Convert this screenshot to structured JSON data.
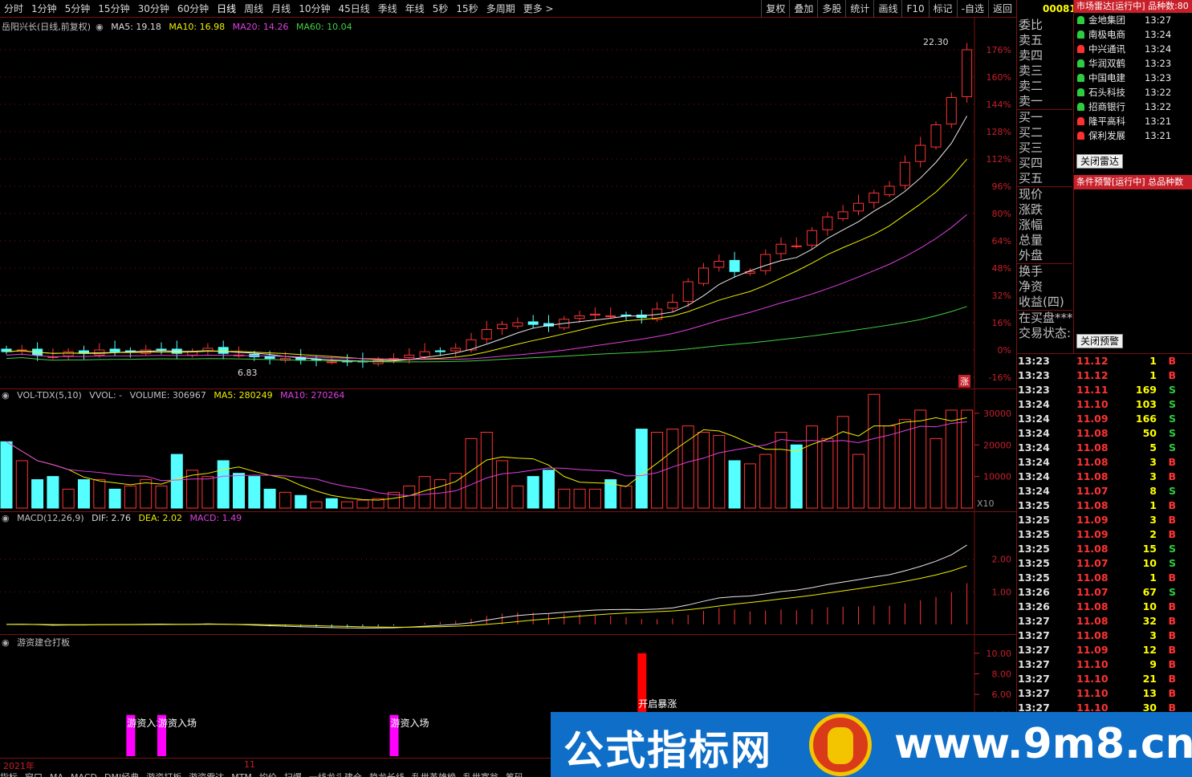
{
  "toolbar": {
    "tabs": [
      "分时",
      "1分钟",
      "5分钟",
      "15分钟",
      "30分钟",
      "60分钟",
      "日线",
      "周线",
      "月线",
      "10分钟",
      "45日线",
      "季线",
      "年线",
      "5秒",
      "15秒",
      "多周期",
      "更多 >"
    ],
    "right_tabs": [
      "复权",
      "叠加",
      "多股",
      "统计",
      "画线",
      "F10",
      "标记",
      "-自选",
      "返回"
    ],
    "code": "00081"
  },
  "price_panel": {
    "title": "岳阳兴长(日线,前复权)",
    "ma5": "MA5: 19.18",
    "ma10": "MA10: 16.98",
    "ma20": "MA20: 14.26",
    "ma60": "MA60: 10.04",
    "high_label": "22.30",
    "low_label": "6.83",
    "zhang": "涨",
    "axis": [
      "176%",
      "160%",
      "144%",
      "128%",
      "112%",
      "96%",
      "80%",
      "64%",
      "48%",
      "32%",
      "16%",
      "0%",
      "-16%"
    ]
  },
  "volume_panel": {
    "title": "VOL-TDX(5,10)",
    "vvol": "VVOL: -",
    "volume": "VOLUME: 306967",
    "ma5": "MA5: 280249",
    "ma10": "MA10: 270264",
    "axis": [
      "30000",
      "20000",
      "10000"
    ],
    "unit": "X10"
  },
  "macd_panel": {
    "title": "MACD(12,26,9)",
    "dif": "DIF: 2.76",
    "dea": "DEA: 2.02",
    "macd": "MACD: 1.49",
    "axis": [
      "2.00",
      "1.00"
    ]
  },
  "signal_panel": {
    "title": "游资建仓打板",
    "axis": [
      "10.00",
      "8.00",
      "6.00",
      "4.00"
    ],
    "labels": [
      "游资入场",
      "游资入场",
      "游资入场",
      "开启暴涨"
    ]
  },
  "timeline": {
    "year": "2021年",
    "month": "11"
  },
  "orderbook": [
    "委比",
    "卖五",
    "卖四",
    "卖三",
    "卖二",
    "卖一",
    "买一",
    "买二",
    "买三",
    "买四",
    "买五",
    "现价",
    "涨跌",
    "涨幅",
    "总量",
    "外盘",
    "换手",
    "净资",
    "收益(四)",
    "在买盘***",
    "交易状态:"
  ],
  "radar": {
    "header": "市场雷达[运行中] 品种数:80",
    "rows": [
      {
        "name": "金地集团",
        "time": "13:27",
        "color": "#2ecc40"
      },
      {
        "name": "南极电商",
        "time": "13:24",
        "color": "#2ecc40"
      },
      {
        "name": "中兴通讯",
        "time": "13:24",
        "color": "#ff3030"
      },
      {
        "name": "华润双鹤",
        "time": "13:23",
        "color": "#2ecc40"
      },
      {
        "name": "中国电建",
        "time": "13:23",
        "color": "#2ecc40"
      },
      {
        "name": "石头科技",
        "time": "13:22",
        "color": "#2ecc40"
      },
      {
        "name": "招商银行",
        "time": "13:22",
        "color": "#2ecc40"
      },
      {
        "name": "隆平高科",
        "time": "13:21",
        "color": "#ff3030"
      },
      {
        "name": "保利发展",
        "time": "13:21",
        "color": "#ff3030"
      }
    ],
    "close_button": "关闭雷达"
  },
  "alert": {
    "header": "条件预警[运行中] 总品种数",
    "close_button": "关闭预警"
  },
  "ticks": [
    [
      "13:23",
      "11.12",
      "1",
      "B"
    ],
    [
      "13:23",
      "11.12",
      "1",
      "B"
    ],
    [
      "13:23",
      "11.11",
      "169",
      "S"
    ],
    [
      "13:24",
      "11.10",
      "103",
      "S"
    ],
    [
      "13:24",
      "11.09",
      "166",
      "S"
    ],
    [
      "13:24",
      "11.08",
      "50",
      "S"
    ],
    [
      "13:24",
      "11.08",
      "5",
      "S"
    ],
    [
      "13:24",
      "11.08",
      "3",
      "B"
    ],
    [
      "13:24",
      "11.08",
      "3",
      "B"
    ],
    [
      "13:24",
      "11.07",
      "8",
      "S"
    ],
    [
      "13:25",
      "11.08",
      "1",
      "B"
    ],
    [
      "13:25",
      "11.09",
      "3",
      "B"
    ],
    [
      "13:25",
      "11.09",
      "2",
      "B"
    ],
    [
      "13:25",
      "11.08",
      "15",
      "S"
    ],
    [
      "13:25",
      "11.07",
      "10",
      "S"
    ],
    [
      "13:25",
      "11.08",
      "1",
      "B"
    ],
    [
      "13:26",
      "11.07",
      "67",
      "S"
    ],
    [
      "13:26",
      "11.08",
      "10",
      "B"
    ],
    [
      "13:27",
      "11.08",
      "32",
      "B"
    ],
    [
      "13:27",
      "11.08",
      "3",
      "B"
    ],
    [
      "13:27",
      "11.09",
      "12",
      "B"
    ],
    [
      "13:27",
      "11.10",
      "9",
      "B"
    ],
    [
      "13:27",
      "11.10",
      "21",
      "B"
    ],
    [
      "13:27",
      "11.10",
      "13",
      "B"
    ],
    [
      "13:27",
      "11.10",
      "30",
      "B"
    ]
  ],
  "bottom_tabs": [
    "指标",
    "窗口",
    "MA",
    "MACD",
    "DMI经典",
    "游资打板",
    "游资雷达",
    "MTM",
    "均价",
    "扫爆",
    "一线龙头建仓",
    "趋龙长线",
    "乱世英雄榜",
    "乱世富翁",
    "筹码"
  ],
  "watermark": {
    "cn": "公式指标网",
    "url": "www.9m8.cn"
  },
  "chart_data": [
    {
      "type": "candlestick",
      "title": "岳阳兴长(日线,前复权)",
      "y_axis": "percent",
      "ylim": [
        -16,
        176
      ],
      "closes_pct": [
        -1,
        0,
        -3,
        -4,
        -1,
        -2,
        0,
        -1,
        -1,
        0,
        0,
        -2,
        -1,
        1,
        -2,
        -3,
        -4,
        -5,
        -5,
        -6,
        -6,
        -7,
        -7,
        -7,
        -6,
        -5,
        -3,
        -1,
        -1,
        1,
        6,
        12,
        15,
        16,
        15,
        14,
        18,
        20,
        21,
        20,
        20,
        19,
        24,
        28,
        40,
        48,
        52,
        46,
        46,
        56,
        62,
        61,
        70,
        78,
        81,
        86,
        92,
        96,
        110,
        120,
        132,
        148,
        176
      ],
      "ma_series": [
        "MA5",
        "MA10",
        "MA20",
        "MA60"
      ]
    },
    {
      "type": "bar",
      "title": "VOL-TDX(5,10)",
      "values": [
        21000,
        15000,
        9000,
        10000,
        6000,
        9000,
        9000,
        6000,
        7000,
        9000,
        7000,
        17000,
        12000,
        10000,
        15000,
        11000,
        10000,
        6000,
        5000,
        4000,
        2000,
        3000,
        2000,
        2500,
        3000,
        5000,
        7000,
        10000,
        9000,
        11000,
        22000,
        24000,
        15000,
        7000,
        10000,
        12000,
        6000,
        6000,
        6000,
        9000,
        7000,
        25000,
        24000,
        25000,
        26000,
        24000,
        23000,
        15000,
        14000,
        17000,
        24000,
        20000,
        26000,
        22000,
        29000,
        17000,
        36000,
        26000,
        28000,
        31000,
        22000,
        31000,
        31000
      ],
      "ylim": [
        0,
        32000
      ]
    },
    {
      "type": "line",
      "title": "MACD(12,26,9)",
      "series": [
        {
          "name": "DIF"
        },
        {
          "name": "DEA"
        },
        {
          "name": "MACD"
        }
      ],
      "ylim": [
        -0.2,
        3.2
      ]
    },
    {
      "type": "bar",
      "title": "游资建仓打板",
      "ylim": [
        0,
        11
      ],
      "bars": [
        {
          "label": "游资入场",
          "value": 4
        },
        {
          "label": "游资入场",
          "value": 4
        },
        {
          "label": "游资入场",
          "value": 4
        },
        {
          "label": "开启暴涨",
          "value": 10
        }
      ]
    }
  ]
}
